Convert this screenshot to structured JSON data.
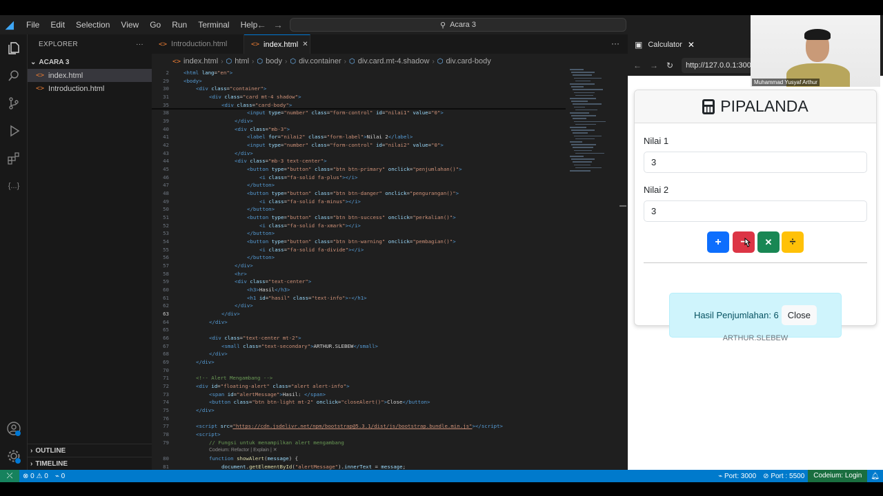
{
  "titlebar": {
    "menu": [
      "File",
      "Edit",
      "Selection",
      "View",
      "Go",
      "Run",
      "Terminal",
      "Help"
    ],
    "search_text": "Acara 3"
  },
  "sidebar": {
    "explorer_label": "EXPLORER",
    "folder": "ACARA 3",
    "files": [
      "index.html",
      "Introduction.html"
    ],
    "outline_label": "OUTLINE",
    "timeline_label": "TIMELINE"
  },
  "editor": {
    "tabs": [
      "Introduction.html",
      "index.html"
    ],
    "breadcrumb": [
      "index.html",
      "html",
      "body",
      "div.container",
      "div.card.mt-4.shadow",
      "div.card-body"
    ],
    "codelens": "Codeium: Refactor | Explain | ✕"
  },
  "browser": {
    "tab_title": "Calculator",
    "url": "http://127.0.0.1:300",
    "app_title": "PIPALANDA",
    "nilai1_label": "Nilai 1",
    "nilai1_value": "3",
    "nilai2_label": "Nilai 2",
    "nilai2_value": "3",
    "buttons": {
      "add": "+",
      "sub": "−",
      "mul": "✕",
      "div": "÷"
    },
    "alert_message": "Hasil Penjumlahan: 6",
    "close_label": "Close",
    "footer": "ARTHUR.SLEBEW",
    "colors": {
      "primary": "#0d6efd",
      "danger": "#dc3545",
      "success": "#198754",
      "warning": "#ffc107",
      "info_bg": "#cff4fc"
    }
  },
  "webcam": {
    "name": "Muhammad Yusyaf Arthur"
  },
  "statusbar": {
    "errors": "0",
    "warnings": "0",
    "ports": "0",
    "port1": "Port: 3000",
    "port2": "Port : 5500",
    "codeium": "Codeium: Login"
  }
}
